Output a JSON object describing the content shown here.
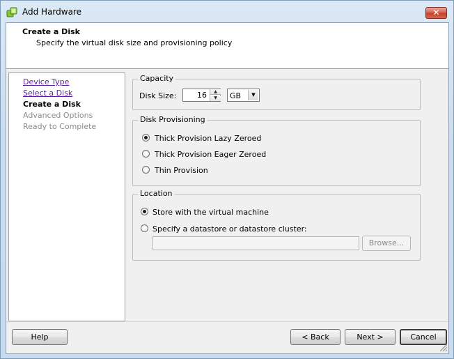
{
  "window": {
    "title": "Add Hardware",
    "close_label": "✕"
  },
  "header": {
    "title": "Create a Disk",
    "subtitle": "Specify the virtual disk size and provisioning policy"
  },
  "nav": {
    "items": [
      {
        "label": "Device Type",
        "state": "link"
      },
      {
        "label": "Select a Disk",
        "state": "link"
      },
      {
        "label": "Create a Disk",
        "state": "current"
      },
      {
        "label": "Advanced Options",
        "state": "disabled"
      },
      {
        "label": "Ready to Complete",
        "state": "disabled"
      }
    ]
  },
  "capacity": {
    "legend": "Capacity",
    "disk_size_label": "Disk Size:",
    "disk_size_value": "16",
    "unit": "GB"
  },
  "provisioning": {
    "legend": "Disk Provisioning",
    "options": [
      {
        "label": "Thick Provision Lazy Zeroed",
        "checked": true
      },
      {
        "label": "Thick Provision Eager Zeroed",
        "checked": false
      },
      {
        "label": "Thin Provision",
        "checked": false
      }
    ]
  },
  "location": {
    "legend": "Location",
    "options": [
      {
        "label": "Store with the virtual machine",
        "checked": true
      },
      {
        "label": "Specify a datastore or datastore cluster:",
        "checked": false
      }
    ],
    "path_value": "",
    "browse_label": "Browse..."
  },
  "footer": {
    "help": "Help",
    "back": "< Back",
    "next": "Next >",
    "cancel": "Cancel"
  },
  "colors": {
    "title_bar": "#c9dbee",
    "link": "#5b1d9f",
    "disabled": "#8a8a8a"
  }
}
